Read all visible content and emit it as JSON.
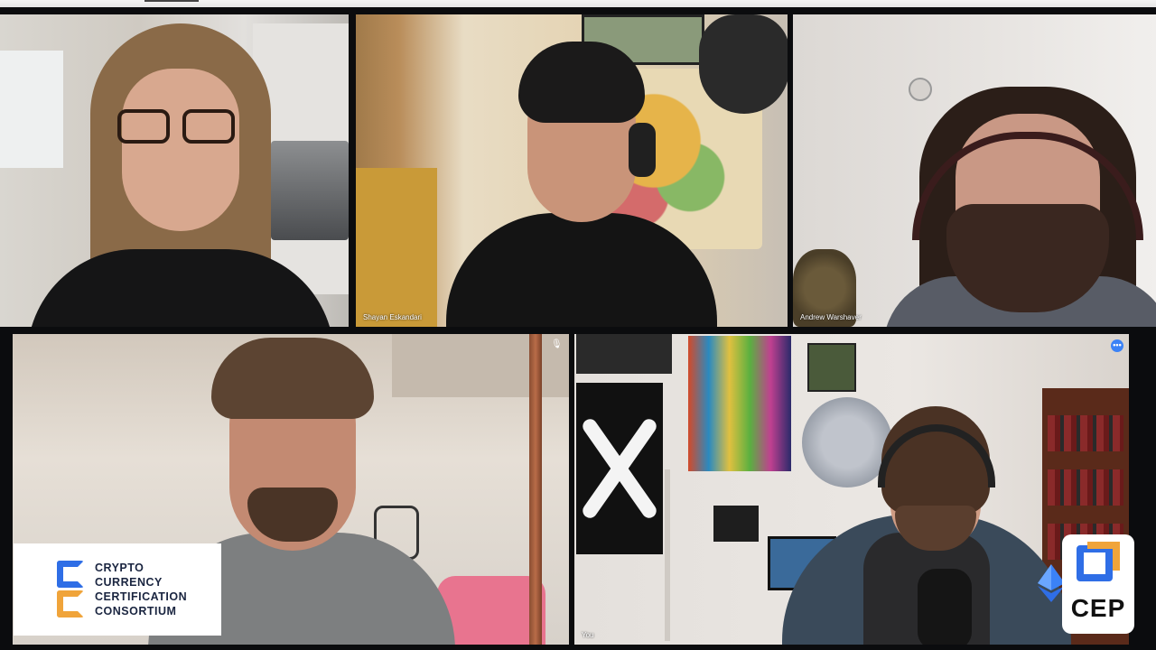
{
  "participants": [
    {
      "id": "t1",
      "name": ""
    },
    {
      "id": "t2",
      "name": "Shayan Eskandari"
    },
    {
      "id": "t3",
      "name": "Andrew Warshaver"
    },
    {
      "id": "t4",
      "name": ""
    },
    {
      "id": "t5",
      "name": "You",
      "active_speaker": true
    }
  ],
  "tile_icons": {
    "t4": "mic-muted-icon",
    "t5": "more-options-icon"
  },
  "more_options_glyph": "•••",
  "muted_glyph": "🎙",
  "logo_left": {
    "lines": [
      "CRYPTO",
      "CURRENCY",
      "CERTIFICATION",
      "CONSORTIUM"
    ],
    "colors": {
      "blue": "#2f6ee6",
      "orange": "#f0a43a",
      "text": "#1a2540"
    }
  },
  "logo_right": {
    "text": "CEP",
    "colors": {
      "blue": "#2f6ee6",
      "orange": "#f0a43a"
    }
  },
  "colors": {
    "active_border": "#3b82f6",
    "background": "#0b0c0e"
  }
}
